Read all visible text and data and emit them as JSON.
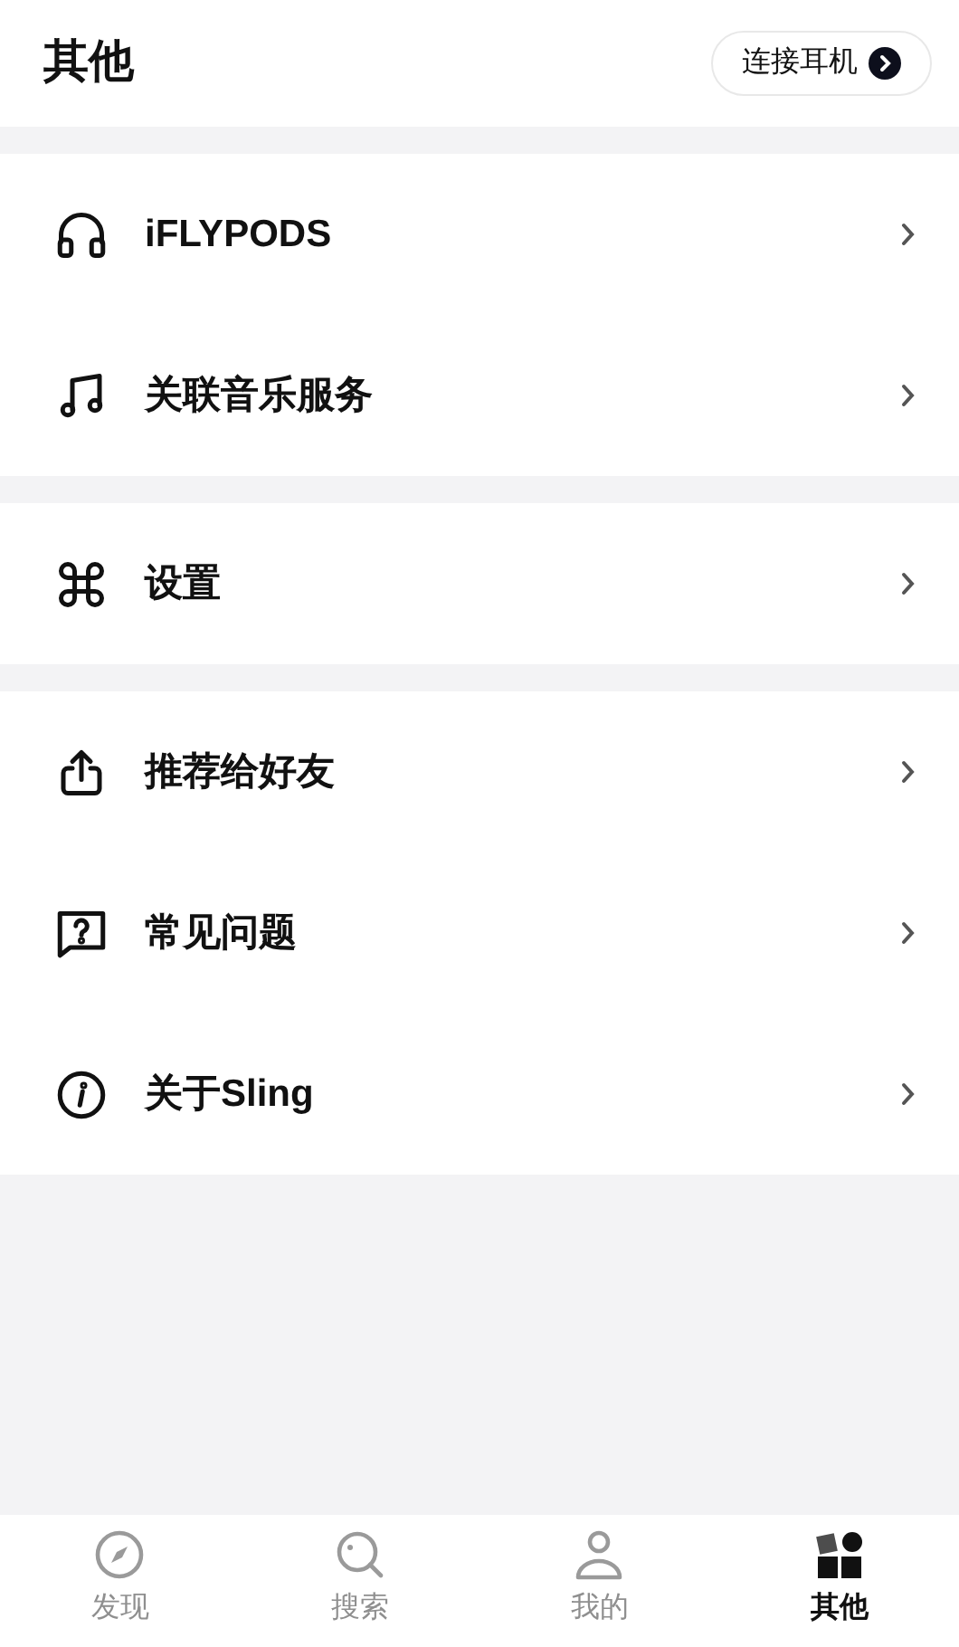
{
  "header": {
    "title": "其他",
    "connect_button": "连接耳机"
  },
  "groups": [
    {
      "items": [
        {
          "label": "iFLYPODS"
        },
        {
          "label": "关联音乐服务"
        }
      ]
    },
    {
      "items": [
        {
          "label": "设置"
        }
      ]
    },
    {
      "items": [
        {
          "label": "推荐给好友"
        },
        {
          "label": "常见问题"
        },
        {
          "label": "关于Sling"
        }
      ]
    }
  ],
  "tab_bar": [
    {
      "label": "发现",
      "selected": false
    },
    {
      "label": "搜索",
      "selected": false
    },
    {
      "label": "我的",
      "selected": false
    },
    {
      "label": "其他",
      "selected": true
    }
  ]
}
